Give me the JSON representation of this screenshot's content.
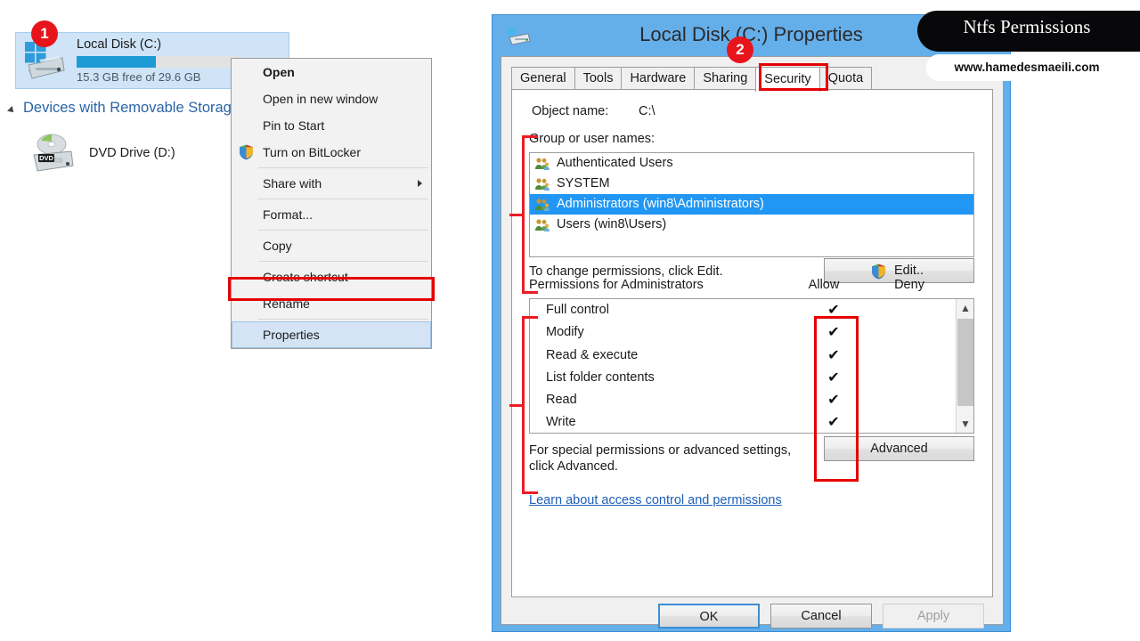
{
  "explorer": {
    "drive": {
      "name": "Local Disk (C:)",
      "free_text": "15.3 GB free of 29.6 GB",
      "used_percent": 48,
      "icon": "hard-drive-icon"
    },
    "section_header": "Devices with Removable Storage",
    "dvd": {
      "name": "DVD Drive (D:)",
      "icon": "dvd-drive-icon",
      "badge_text": "DVD"
    }
  },
  "context_menu": {
    "items": [
      {
        "label": "Open",
        "bold": true,
        "icon": null,
        "submenu": false,
        "selected": false
      },
      {
        "label": "Open in new window",
        "bold": false,
        "icon": null,
        "submenu": false,
        "selected": false
      },
      {
        "label": "Pin to Start",
        "bold": false,
        "icon": null,
        "submenu": false,
        "selected": false
      },
      {
        "label": "Turn on BitLocker",
        "bold": false,
        "icon": "shield-icon",
        "submenu": false,
        "selected": false
      },
      {
        "label": "Share with",
        "bold": false,
        "icon": null,
        "submenu": true,
        "selected": false
      },
      {
        "label": "Format...",
        "bold": false,
        "icon": null,
        "submenu": false,
        "selected": false
      },
      {
        "label": "Copy",
        "bold": false,
        "icon": null,
        "submenu": false,
        "selected": false
      },
      {
        "label": "Create shortcut",
        "bold": false,
        "icon": null,
        "submenu": false,
        "selected": false
      },
      {
        "label": "Rename",
        "bold": false,
        "icon": null,
        "submenu": false,
        "selected": false
      },
      {
        "label": "Properties",
        "bold": false,
        "icon": null,
        "submenu": false,
        "selected": true
      }
    ]
  },
  "badges": [
    {
      "id": "1",
      "text": "1"
    },
    {
      "id": "2",
      "text": "2"
    }
  ],
  "dialog": {
    "title": "Local Disk (C:) Properties",
    "title_icon": "hard-drive-icon",
    "tabs": [
      {
        "label": "General",
        "active": false
      },
      {
        "label": "Tools",
        "active": false
      },
      {
        "label": "Hardware",
        "active": false
      },
      {
        "label": "Sharing",
        "active": false
      },
      {
        "label": "Security",
        "active": true
      },
      {
        "label": "Quota",
        "active": false
      }
    ],
    "security": {
      "object_name_label": "Object name:",
      "object_name_value": "C:\\",
      "group_label": "Group or user names:",
      "users": [
        {
          "name": "Authenticated Users",
          "selected": false
        },
        {
          "name": "SYSTEM",
          "selected": false
        },
        {
          "name": "Administrators (win8\\Administrators)",
          "selected": true
        },
        {
          "name": "Users (win8\\Users)",
          "selected": false
        }
      ],
      "edit_hint": "To change permissions, click Edit.",
      "edit_button": "Edit..",
      "permissions_label": "Permissions for Administrators",
      "col_allow": "Allow",
      "col_deny": "Deny",
      "permissions": [
        {
          "name": "Full control",
          "allow": "✔",
          "deny": ""
        },
        {
          "name": "Modify",
          "allow": "✔",
          "deny": ""
        },
        {
          "name": "Read & execute",
          "allow": "✔",
          "deny": ""
        },
        {
          "name": "List folder contents",
          "allow": "✔",
          "deny": ""
        },
        {
          "name": "Read",
          "allow": "✔",
          "deny": ""
        },
        {
          "name": "Write",
          "allow": "✔",
          "deny": ""
        }
      ],
      "advanced_hint_line1": "For special permissions or advanced settings,",
      "advanced_hint_line2": "click Advanced.",
      "advanced_button": "Advanced",
      "learn_link": "Learn about access control and permissions"
    },
    "footer": {
      "ok": "OK",
      "cancel": "Cancel",
      "apply": "Apply"
    }
  },
  "watermark": {
    "title": "Ntfs Permissions",
    "url": "www.hamedesmaeili.com"
  },
  "colors": {
    "accent_blue": "#64aeea",
    "selection_blue": "#2196f3",
    "annotation_red": "#ed1c24",
    "badge_red": "#e8141c",
    "link_blue": "#1d5fb8",
    "usage_bar": "#1e9ad6"
  }
}
